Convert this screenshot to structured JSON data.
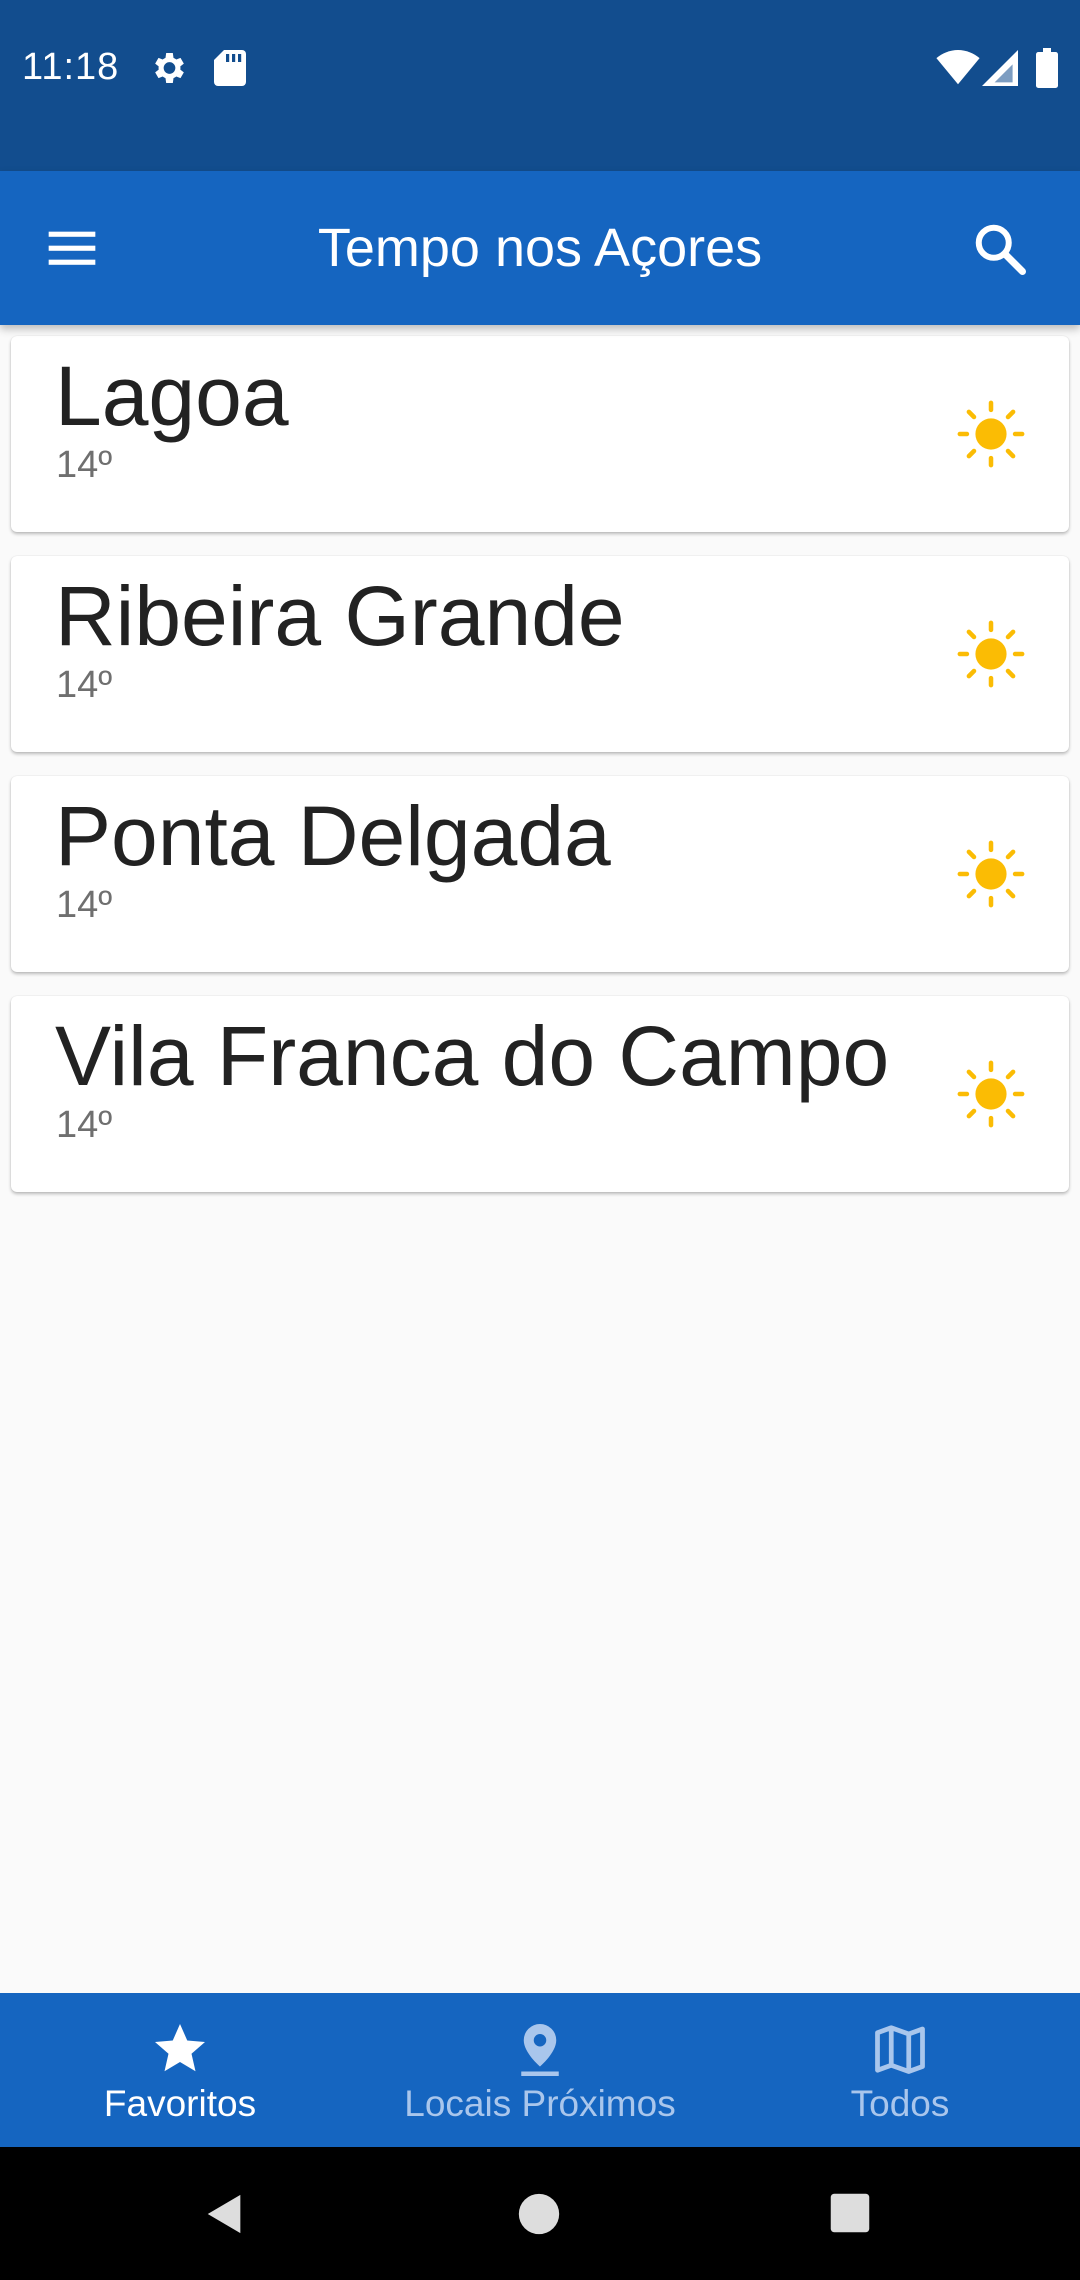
{
  "status_bar": {
    "time": "11:18",
    "icons": [
      "gear-icon",
      "sd-card-icon",
      "wifi-icon",
      "signal-icon",
      "battery-icon"
    ]
  },
  "app_bar": {
    "title": "Tempo nos Açores",
    "menu_icon": "hamburger-menu-icon",
    "search_icon": "search-icon",
    "color": "#1565c0"
  },
  "locations": [
    {
      "name": "Lagoa",
      "temp": "14º",
      "weather_icon": "sun-icon"
    },
    {
      "name": "Ribeira Grande",
      "temp": "14º",
      "weather_icon": "sun-icon"
    },
    {
      "name": "Ponta Delgada",
      "temp": "14º",
      "weather_icon": "sun-icon"
    },
    {
      "name": "Vila Franca do Campo",
      "temp": "14º",
      "weather_icon": "sun-icon"
    }
  ],
  "bottom_nav": {
    "items": [
      {
        "label": "Favoritos",
        "icon": "star-icon",
        "active": true
      },
      {
        "label": "Locais Próximos",
        "icon": "location-pin-icon",
        "active": false
      },
      {
        "label": "Todos",
        "icon": "map-icon",
        "active": false
      }
    ]
  },
  "colors": {
    "status_bar": "#124d8e",
    "primary": "#1565c0",
    "sun": "#fbbc04",
    "background": "#fafafa"
  }
}
